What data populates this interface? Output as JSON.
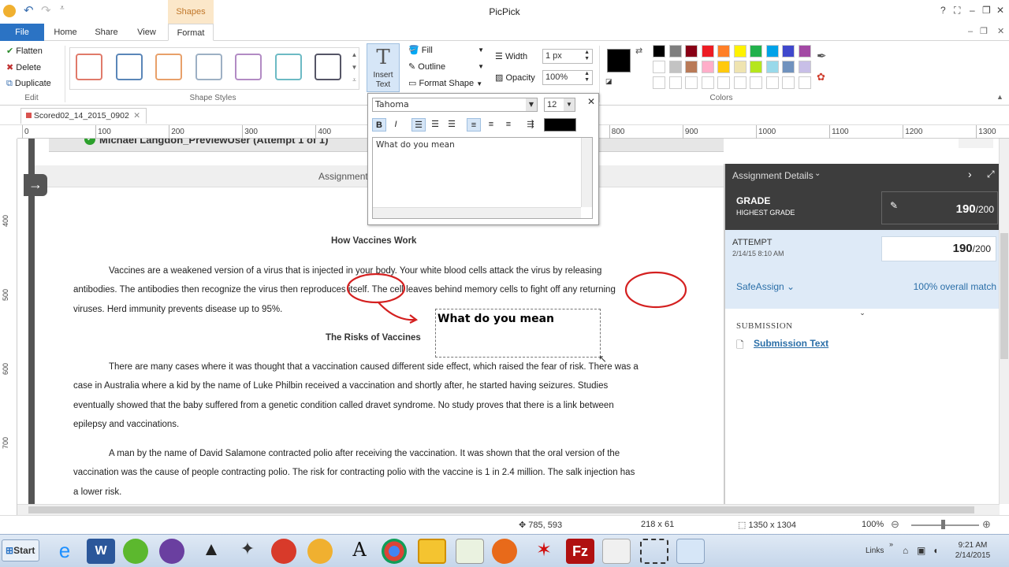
{
  "app": {
    "title": "PicPick",
    "context_tab": "Shapes"
  },
  "tabs": [
    "File",
    "Home",
    "Share",
    "View",
    "Format"
  ],
  "edit": {
    "flatten": "Flatten",
    "delete": "Delete",
    "duplicate": "Duplicate",
    "label": "Edit"
  },
  "shape_styles": {
    "label": "Shape Styles",
    "colors": [
      "#e07a6a",
      "#5a86b8",
      "#e8a06a",
      "#9db0c4",
      "#b28bc4",
      "#6cbac4",
      "#555566"
    ]
  },
  "insert_text": {
    "line1": "Insert",
    "line2": "Text",
    "glyph": "T"
  },
  "format": {
    "fill": "Fill",
    "outline": "Outline",
    "format_shape": "Format Shape",
    "width_label": "Width",
    "width_value": "1 px",
    "opacity_label": "Opacity",
    "opacity_value": "100%"
  },
  "colors": {
    "label": "Colors",
    "row1": [
      "#000000",
      "#7f7f7f",
      "#880015",
      "#ed1c24",
      "#ff7f27",
      "#fff200",
      "#22b14c",
      "#00a2e8",
      "#3f48cc",
      "#a349a4"
    ],
    "row2": [
      "#ffffff",
      "#c3c3c3",
      "#b97a57",
      "#ffaec9",
      "#ffc90e",
      "#efe4b0",
      "#b5e61d",
      "#99d9ea",
      "#7092be",
      "#c8bfe7"
    ]
  },
  "doc_tab": {
    "name": "Scored02_14_2015_0902"
  },
  "ruler": {
    "h": [
      "0",
      "100",
      "200",
      "300",
      "400",
      "500",
      "600",
      "700",
      "800",
      "900",
      "1000",
      "1100",
      "1200",
      "1300"
    ],
    "v": [
      "400",
      "500",
      "600",
      "700"
    ]
  },
  "text_dialog": {
    "font": "Tahoma",
    "size": "12",
    "text": "What do you mean"
  },
  "page": {
    "header_partial": "Michael Langdon_PreviewUser (Attempt 1 of 1)",
    "assignment_label": "Assignment",
    "essay_title": "How Vaccines Work",
    "p1a": "Vaccines are a weakened version of a virus that is injected in your body. Your white blood cells attack the virus by releasing",
    "p1b": "antibodies. The antibodies then recognize the virus then reproduces itself. The cell leaves behind memory cells to fight off any returning",
    "p1c": "viruses. Herd immunity prevents disease up to 95%.",
    "risks_title": "The Risks of Vaccines",
    "p2a": "There are many cases where it was thought that a vaccination caused different side effect, which raised the fear of risk. There was a",
    "p2b": "case in Australia where a kid by the name of Luke Philbin received a vaccination and shortly after, he started having seizures. Studies",
    "p2c": "eventually showed that the baby suffered from a genetic condition called dravet syndrome. No study proves that there is a link between",
    "p2d": "epilepsy and vaccinations.",
    "p3a": "A man by the name of David Salamone contracted polio after receiving the vaccination. It was shown that the oral version of the",
    "p3b": "vaccination was the cause of people contracting polio. The risk for contracting polio with the vaccine is 1 in 2.4 million. The salk injection has",
    "p3c": "a lower risk.",
    "textbox": "What do you mean"
  },
  "panel": {
    "title": "Assignment Details",
    "grade": "GRADE",
    "highest": "HIGHEST GRADE",
    "score": "190",
    "total": "/200",
    "attempt": "ATTEMPT",
    "attempt_date": "2/14/15 8:10 AM",
    "safeassign": "SafeAssign",
    "match": "100% overall match",
    "submission": "SUBMISSION",
    "submission_text": "Submission Text"
  },
  "status": {
    "cursor": "785, 593",
    "selection": "218 x 61",
    "image_size": "1350 x 1304",
    "zoom": "100%"
  },
  "taskbar": {
    "start": "Start",
    "links": "Links",
    "time": "9:21 AM",
    "date": "2/14/2015"
  }
}
